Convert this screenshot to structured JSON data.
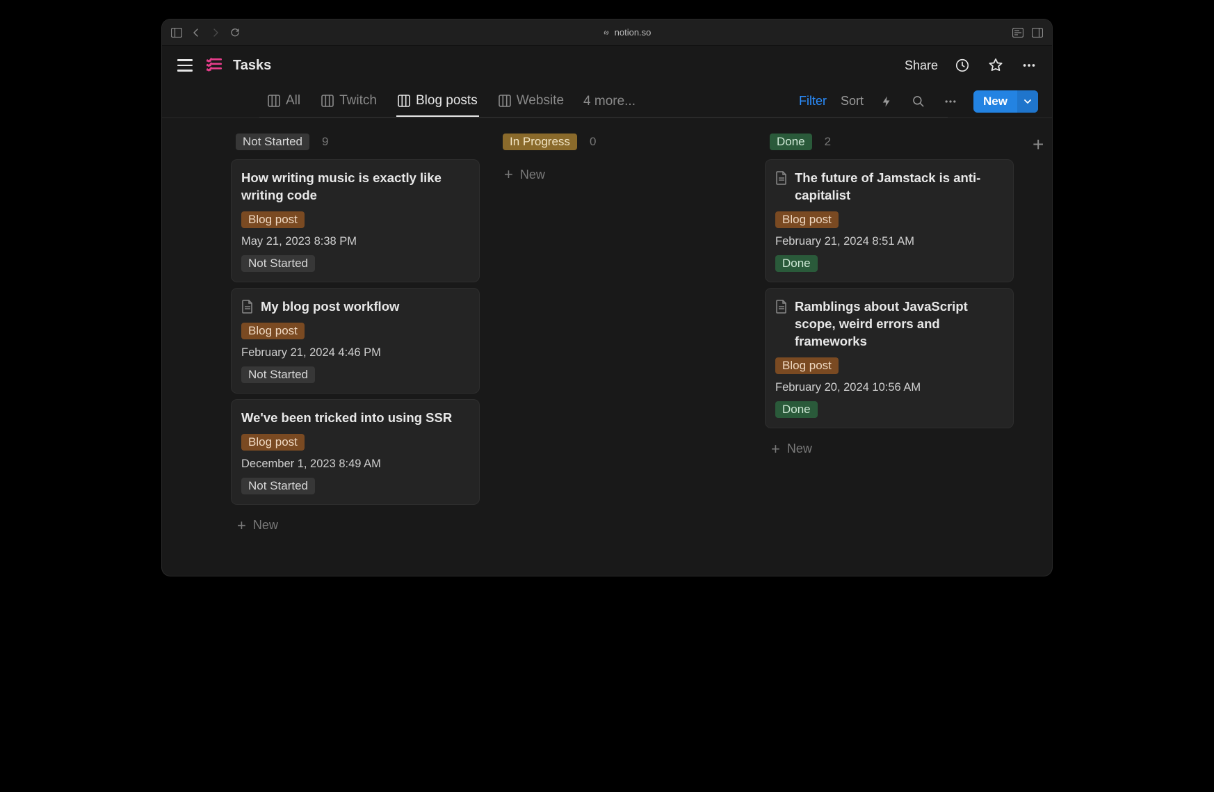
{
  "domain": "Computer-Use",
  "browser": {
    "url_host": "notion.so"
  },
  "header": {
    "page_title": "Tasks",
    "share_label": "Share"
  },
  "tabs": {
    "items": [
      {
        "label": "All",
        "active": false
      },
      {
        "label": "Twitch",
        "active": false
      },
      {
        "label": "Blog posts",
        "active": true
      },
      {
        "label": "Website",
        "active": false
      }
    ],
    "overflow_label": "4 more...",
    "filter_label": "Filter",
    "sort_label": "Sort",
    "new_label": "New"
  },
  "board": {
    "new_item_label": "New",
    "columns": [
      {
        "id": "not-started",
        "label": "Not Started",
        "pill_class": "gray",
        "count": "9",
        "cards": [
          {
            "title": "How writing music is exactly like writing code",
            "has_icon": false,
            "tag": "Blog post",
            "date": "May 21, 2023 8:38 PM",
            "status": "Not Started",
            "status_class": "gray"
          },
          {
            "title": "My blog post workflow",
            "has_icon": true,
            "tag": "Blog post",
            "date": "February 21, 2024 4:46 PM",
            "status": "Not Started",
            "status_class": "gray"
          },
          {
            "title": "We've been tricked into using SSR",
            "has_icon": false,
            "tag": "Blog post",
            "date": "December 1, 2023 8:49 AM",
            "status": "Not Started",
            "status_class": "gray"
          }
        ]
      },
      {
        "id": "in-progress",
        "label": "In Progress",
        "pill_class": "amber",
        "count": "0",
        "cards": []
      },
      {
        "id": "done",
        "label": "Done",
        "pill_class": "green",
        "count": "2",
        "cards": [
          {
            "title": "The future of Jamstack is anti-capitalist",
            "has_icon": true,
            "tag": "Blog post",
            "date": "February 21, 2024 8:51 AM",
            "status": "Done",
            "status_class": "green"
          },
          {
            "title": "Ramblings about JavaScript scope, weird errors and frameworks",
            "has_icon": true,
            "tag": "Blog post",
            "date": "February 20, 2024 10:56 AM",
            "status": "Done",
            "status_class": "green"
          }
        ]
      }
    ]
  },
  "icons": {
    "page_icon_color": "#e83e8c"
  }
}
